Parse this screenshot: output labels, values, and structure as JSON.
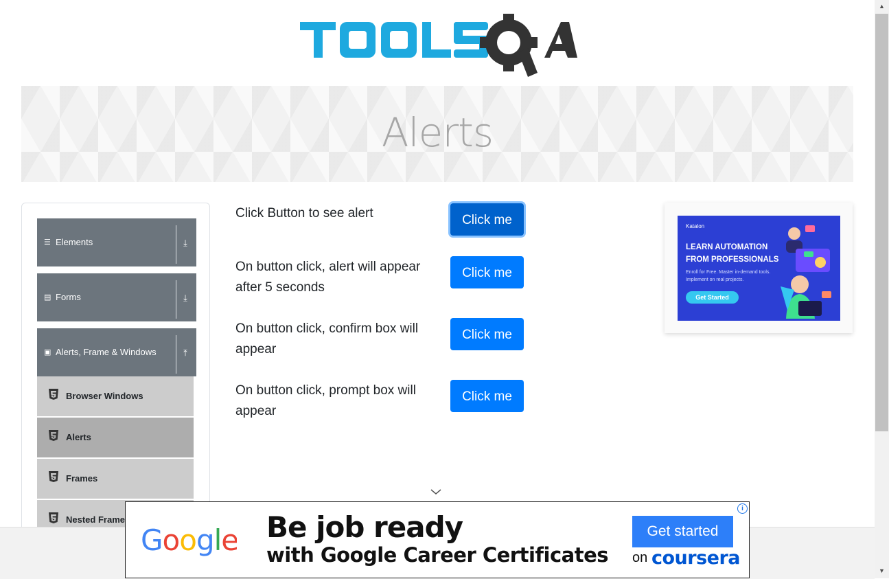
{
  "header": {
    "logo_text": "TOOLSQA",
    "logo_colors": {
      "tools": "#1ea9df",
      "qa": "#3c3c3c"
    }
  },
  "banner": {
    "title": "Alerts"
  },
  "sidebar": {
    "groups": [
      {
        "label": "Elements",
        "icon": "hamburger-icon",
        "arrow": "download-arrow-icon"
      },
      {
        "label": "Forms",
        "icon": "form-icon",
        "arrow": "download-arrow-icon"
      },
      {
        "label": "Alerts, Frame & Windows",
        "icon": "window-icon",
        "arrow": "upload-arrow-icon"
      }
    ],
    "items": [
      {
        "label": "Browser Windows",
        "active": false
      },
      {
        "label": "Alerts",
        "active": true
      },
      {
        "label": "Frames",
        "active": false
      },
      {
        "label": "Nested Frames",
        "active": false
      }
    ]
  },
  "main": {
    "rows": [
      {
        "text": "Click Button to see alert",
        "button": "Click me"
      },
      {
        "text": "On button click, alert will appear after 5 seconds",
        "button": "Click me"
      },
      {
        "text": "On button click, confirm box will appear",
        "button": "Click me"
      },
      {
        "text": "On button click, prompt box will appear",
        "button": "Click me"
      }
    ]
  },
  "side_ad": {
    "brand": "Katalon",
    "headline": "LEARN AUTOMATION FROM PROFESSIONALS",
    "subtext": "Enroll for Free. Master in-demand tools. Implement on real projects.",
    "cta": "Get Started"
  },
  "bottom_ad": {
    "logo": "Google",
    "line1": "Be job ready",
    "line2": "with Google Career Certificates",
    "cta": "Get started",
    "on": "on",
    "partner": "coursera",
    "info": "i"
  },
  "colors": {
    "primary": "#007bff",
    "sidebar_header": "#6c757d",
    "menu_item": "#cccccc",
    "menu_item_active": "#adadad"
  }
}
